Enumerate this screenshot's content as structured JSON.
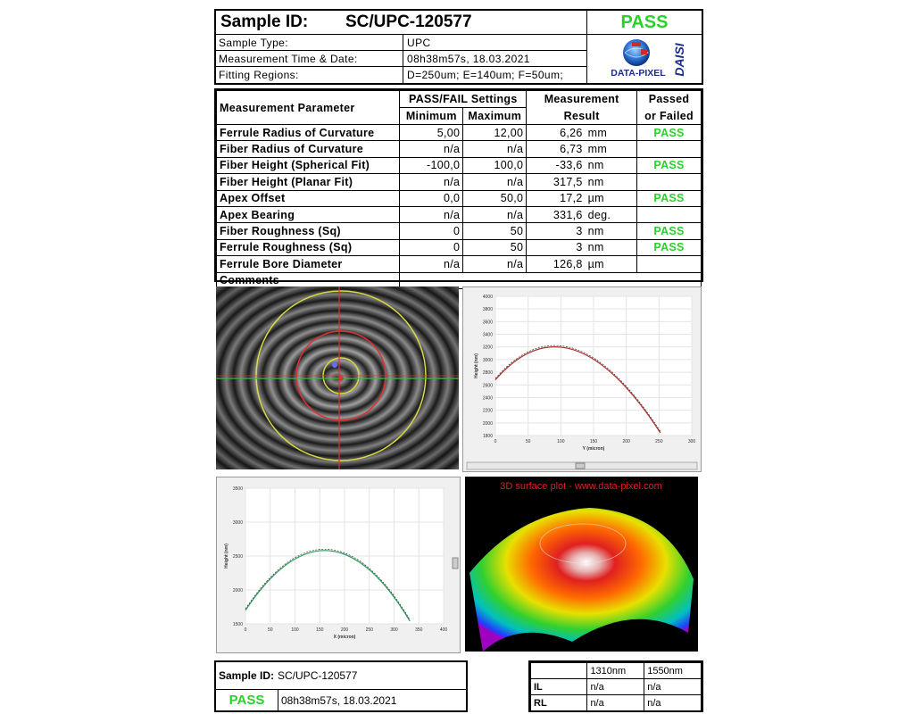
{
  "header": {
    "sample_id_label": "Sample ID:",
    "sample_id": "SC/UPC-120577",
    "result": "PASS",
    "rows": [
      {
        "key": "Sample Type:",
        "value": "UPC"
      },
      {
        "key": "Measurement Time & Date:",
        "value": "08h38m57s,  18.03.2021"
      },
      {
        "key": "Fitting Regions:",
        "value": "D=250um;   E=140um;   F=50um;"
      }
    ],
    "logo_brand": "DATA-PIXEL",
    "logo_side": "DAISI"
  },
  "table": {
    "col_param": "Measurement Parameter",
    "col_settings": "PASS/FAIL Settings",
    "col_min": "Minimum",
    "col_max": "Maximum",
    "col_result_1": "Measurement",
    "col_result_2": "Result",
    "col_pf_1": "Passed",
    "col_pf_2": "or Failed",
    "rows": [
      {
        "name": "Ferrule Radius of Curvature",
        "min": "5,00",
        "max": "12,00",
        "result": "6,26",
        "unit": "mm",
        "pf": "PASS"
      },
      {
        "name": "Fiber Radius of Curvature",
        "min": "n/a",
        "max": "n/a",
        "result": "6,73",
        "unit": "mm",
        "pf": ""
      },
      {
        "name": "Fiber Height (Spherical Fit)",
        "min": "-100,0",
        "max": "100,0",
        "result": "-33,6",
        "unit": "nm",
        "pf": "PASS"
      },
      {
        "name": "Fiber Height (Planar Fit)",
        "min": "n/a",
        "max": "n/a",
        "result": "317,5",
        "unit": "nm",
        "pf": ""
      },
      {
        "name": "Apex Offset",
        "min": "0,0",
        "max": "50,0",
        "result": "17,2",
        "unit": "µm",
        "pf": "PASS"
      },
      {
        "name": "Apex Bearing",
        "min": "n/a",
        "max": "n/a",
        "result": "331,6",
        "unit": "deg.",
        "pf": ""
      },
      {
        "name": "Fiber Roughness (Sq)",
        "min": "0",
        "max": "50",
        "result": "3",
        "unit": "nm",
        "pf": "PASS"
      },
      {
        "name": "Ferrule Roughness (Sq)",
        "min": "0",
        "max": "50",
        "result": "3",
        "unit": "nm",
        "pf": "PASS"
      },
      {
        "name": "Ferrule Bore Diameter",
        "min": "n/a",
        "max": "n/a",
        "result": "126,8",
        "unit": "µm",
        "pf": ""
      }
    ],
    "comments_label": "Comments"
  },
  "plot_y": {
    "ylabel": "Height (nm)",
    "xlabel": "Y (micron)",
    "yticks": [
      "4000",
      "3800",
      "3600",
      "3400",
      "3200",
      "3000",
      "2800",
      "2600",
      "2400",
      "2200",
      "2000",
      "1800"
    ],
    "xticks": [
      "0",
      "50",
      "100",
      "150",
      "200",
      "250",
      "300"
    ],
    "ylim": [
      1800,
      4000
    ],
    "xlim": [
      0,
      300
    ]
  },
  "plot_x": {
    "ylabel": "Height (nm)",
    "xlabel": "X (micron)",
    "yticks": [
      "3500",
      "3000",
      "2500",
      "2000",
      "1500"
    ],
    "xticks": [
      "0",
      "50",
      "100",
      "150",
      "200",
      "250",
      "300",
      "350",
      "400"
    ],
    "xlim": [
      0,
      420
    ]
  },
  "surface": {
    "title": "3D surface plot - www.data-pixel.com"
  },
  "footer": {
    "sample_id_label": "Sample ID:",
    "sample_id": "SC/UPC-120577",
    "result": "PASS",
    "datetime": "08h38m57s,  18.03.2021",
    "loss_cols": [
      "1310nm",
      "1550nm"
    ],
    "loss_rows": [
      {
        "label": "IL",
        "v1": "n/a",
        "v2": "n/a"
      },
      {
        "label": "RL",
        "v1": "n/a",
        "v2": "n/a"
      }
    ]
  },
  "colors": {
    "pass": "#2bd12b",
    "fit_red": "#b03030",
    "fit_green": "#2a9a5a"
  }
}
